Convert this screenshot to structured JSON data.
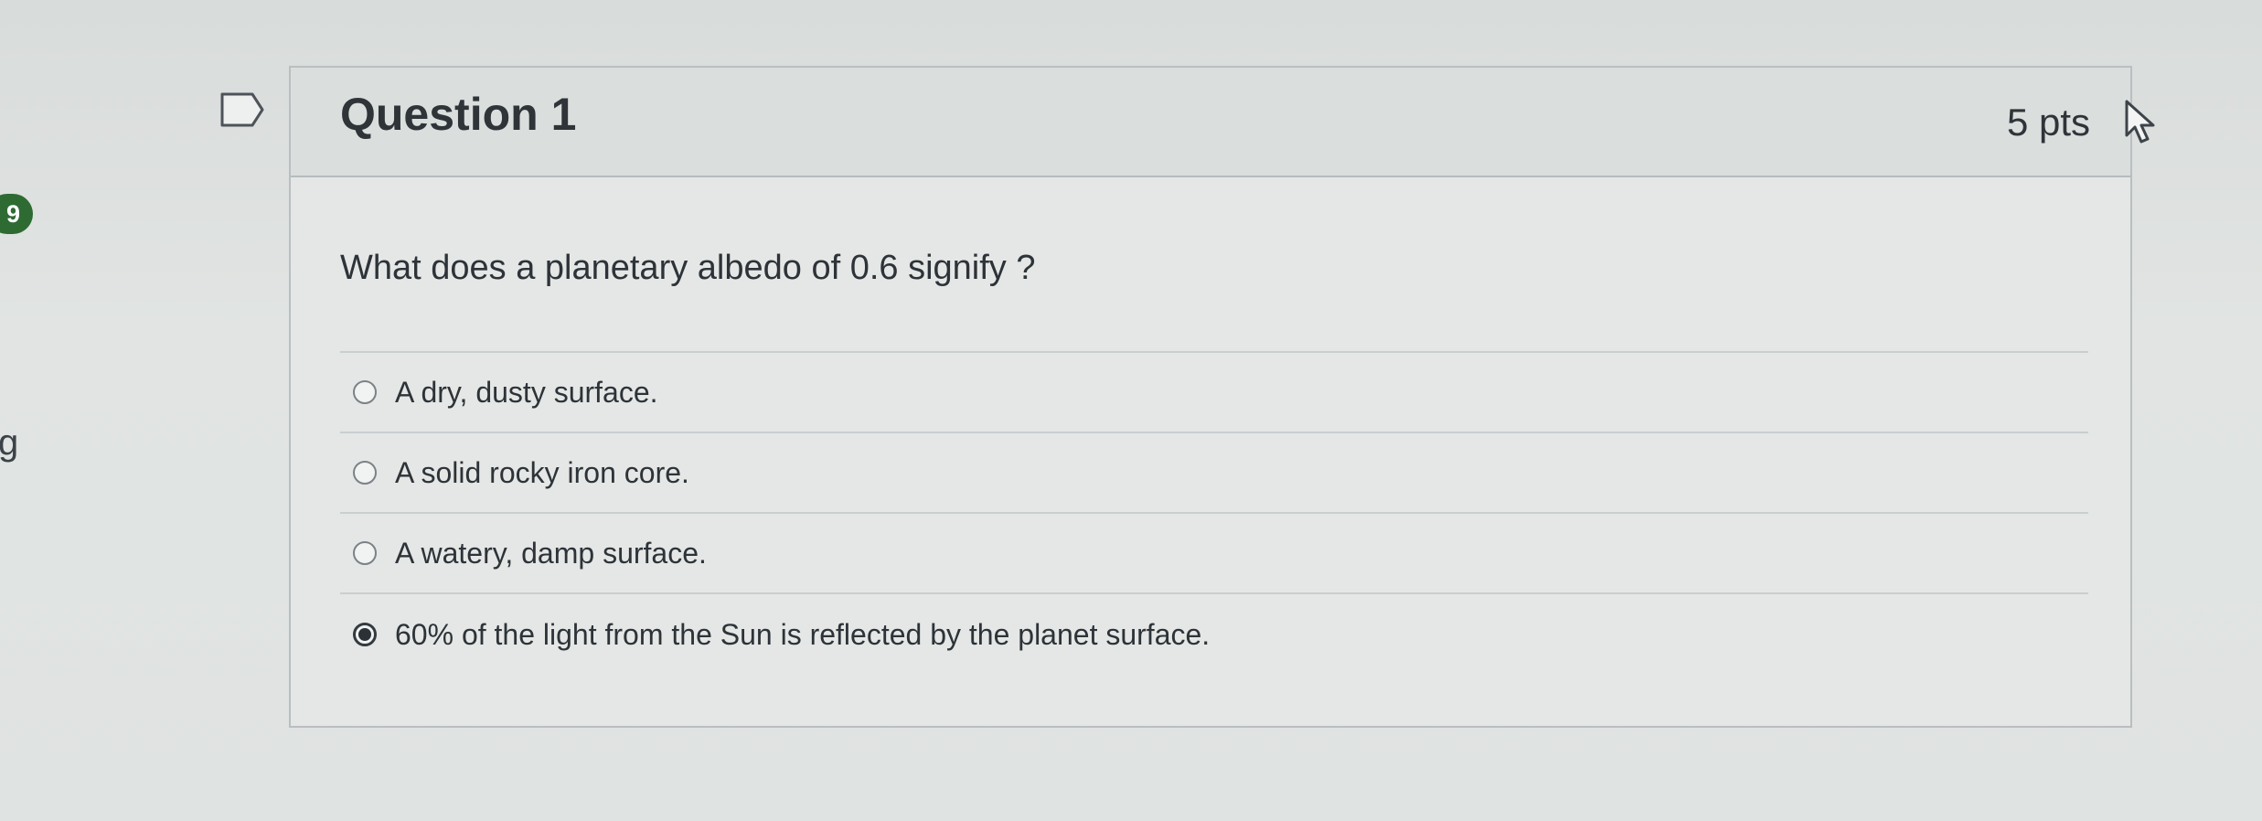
{
  "sidebar_fragments": {
    "badge": "9",
    "letter": "g"
  },
  "question": {
    "title": "Question 1",
    "points": "5 pts",
    "text": "What does a planetary albedo of 0.6 signify ?",
    "answers": [
      {
        "label": "A dry, dusty surface.",
        "selected": false
      },
      {
        "label": "A solid rocky iron core.",
        "selected": false
      },
      {
        "label": "A watery, damp surface.",
        "selected": false
      },
      {
        "label": "60% of the light from the Sun is reflected by the planet surface.",
        "selected": true
      }
    ]
  },
  "icons": {
    "flag": "bookmark-flag-icon",
    "cursor": "mouse-pointer-icon"
  },
  "colors": {
    "badge": "#2e6b33",
    "border": "#b9bfc1",
    "text": "#2d3338"
  }
}
